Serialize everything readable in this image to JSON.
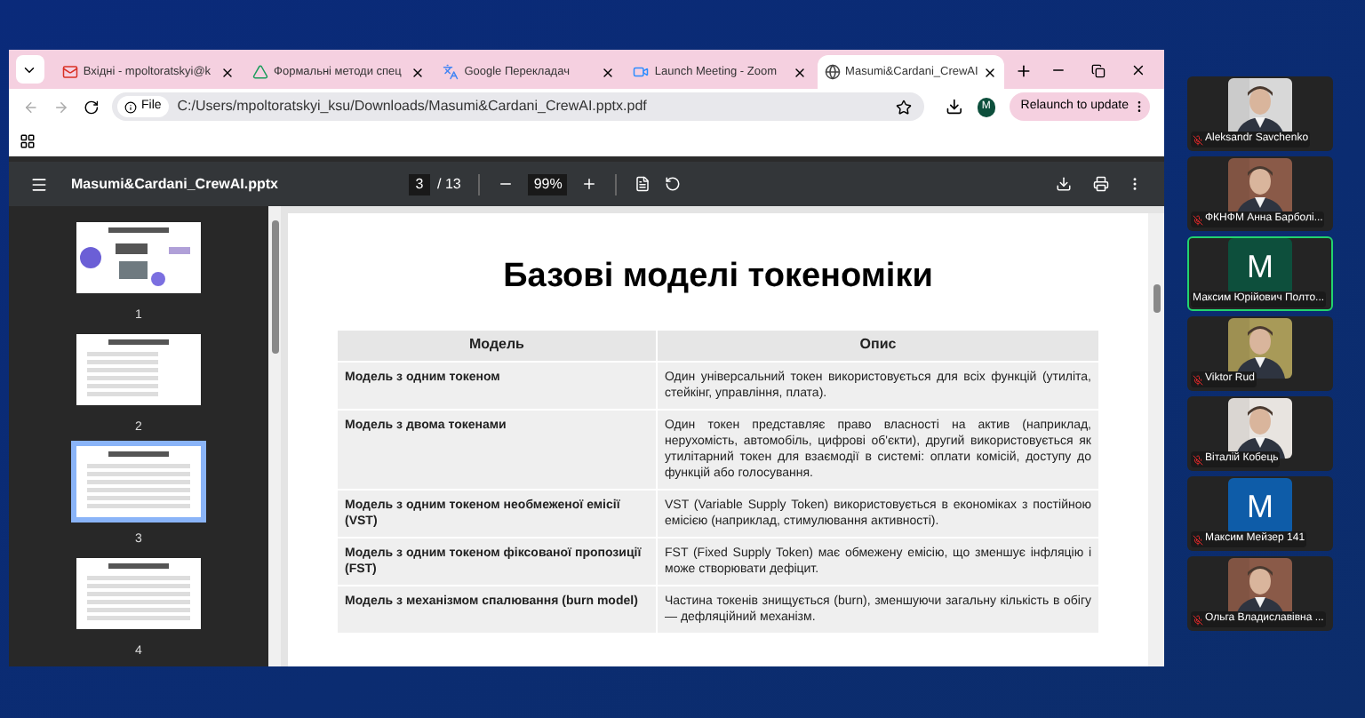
{
  "browser": {
    "tabs": [
      {
        "title": "Вхідні - mpoltoratskyi@k",
        "kind": "mail",
        "selected": false
      },
      {
        "title": "Формальні методи спец",
        "kind": "drive",
        "selected": false
      },
      {
        "title": "Google Перекладач",
        "kind": "translate",
        "selected": false
      },
      {
        "title": "Launch Meeting - Zoom",
        "kind": "zoom",
        "selected": false
      },
      {
        "title": "Masumi&Cardani_CrewAI",
        "kind": "globe",
        "selected": true
      }
    ],
    "address": {
      "scheme": "File",
      "url": "C:/Users/mpoltoratskyi_ksu/Downloads/Masumi&Cardani_CrewAI.pptx.pdf"
    },
    "profile": "M",
    "relaunch": "Relaunch to update"
  },
  "pdf": {
    "filename": "Masumi&Cardani_CrewAI.pptx",
    "page": "3",
    "total": "/ 13",
    "zoom": "99%",
    "thumbnails": [
      {
        "number": "1",
        "selected": false
      },
      {
        "number": "2",
        "selected": false
      },
      {
        "number": "3",
        "selected": true
      },
      {
        "number": "4",
        "selected": false
      }
    ],
    "slide": {
      "title": "Базові моделі токеноміки",
      "columns": [
        "Модель",
        "Опис"
      ],
      "rows": [
        [
          "Модель з одним токеном",
          "Один універсальний токен використовується для всіх функцій (утиліта, стейкінг, управління, плата)."
        ],
        [
          "Модель з двома токенами",
          "Один токен представляє право власності на актив (наприклад, нерухомість, автомобіль, цифрові об'єкти), другий використовується як утилітарний токен для взаємодії в системі: оплати комісій, доступу до функцій або голосування."
        ],
        [
          "Модель з одним токеном необмеженої емісії (VST)",
          "VST (Variable Supply Token) використовується в економіках з постійною емісією (наприклад, стимулювання активності)."
        ],
        [
          "Модель з одним токеном фіксованої пропозиції (FST)",
          "FST (Fixed Supply Token) має обмежену емісію, що зменшує інфляцію і може створювати дефіцит."
        ],
        [
          "Модель з механізмом спалювання (burn model)",
          "Частина токенів знищується (burn), зменшуючи загальну кількість в обігу — дефляційний механізм."
        ]
      ]
    }
  },
  "participants": [
    {
      "name": "Aleksandr Savchenko",
      "muted": true,
      "active": false
    },
    {
      "name": "ФКНФМ Анна Барболі...",
      "muted": true,
      "active": false
    },
    {
      "name": "Максим Юрійович Полто...",
      "kind": "initial",
      "initial": "M",
      "color": "#0d4f3c",
      "muted": false,
      "active": true
    },
    {
      "name": "Viktor Rud",
      "muted": true,
      "active": false
    },
    {
      "name": "Віталій Кобець",
      "muted": true,
      "active": false
    },
    {
      "name": "Максим Мейзер 141",
      "kind": "initial",
      "initial": "M",
      "color": "#0e5ca8",
      "muted": true,
      "active": false
    },
    {
      "name": "Ольга Владиславівна ...",
      "muted": true,
      "active": false
    }
  ]
}
